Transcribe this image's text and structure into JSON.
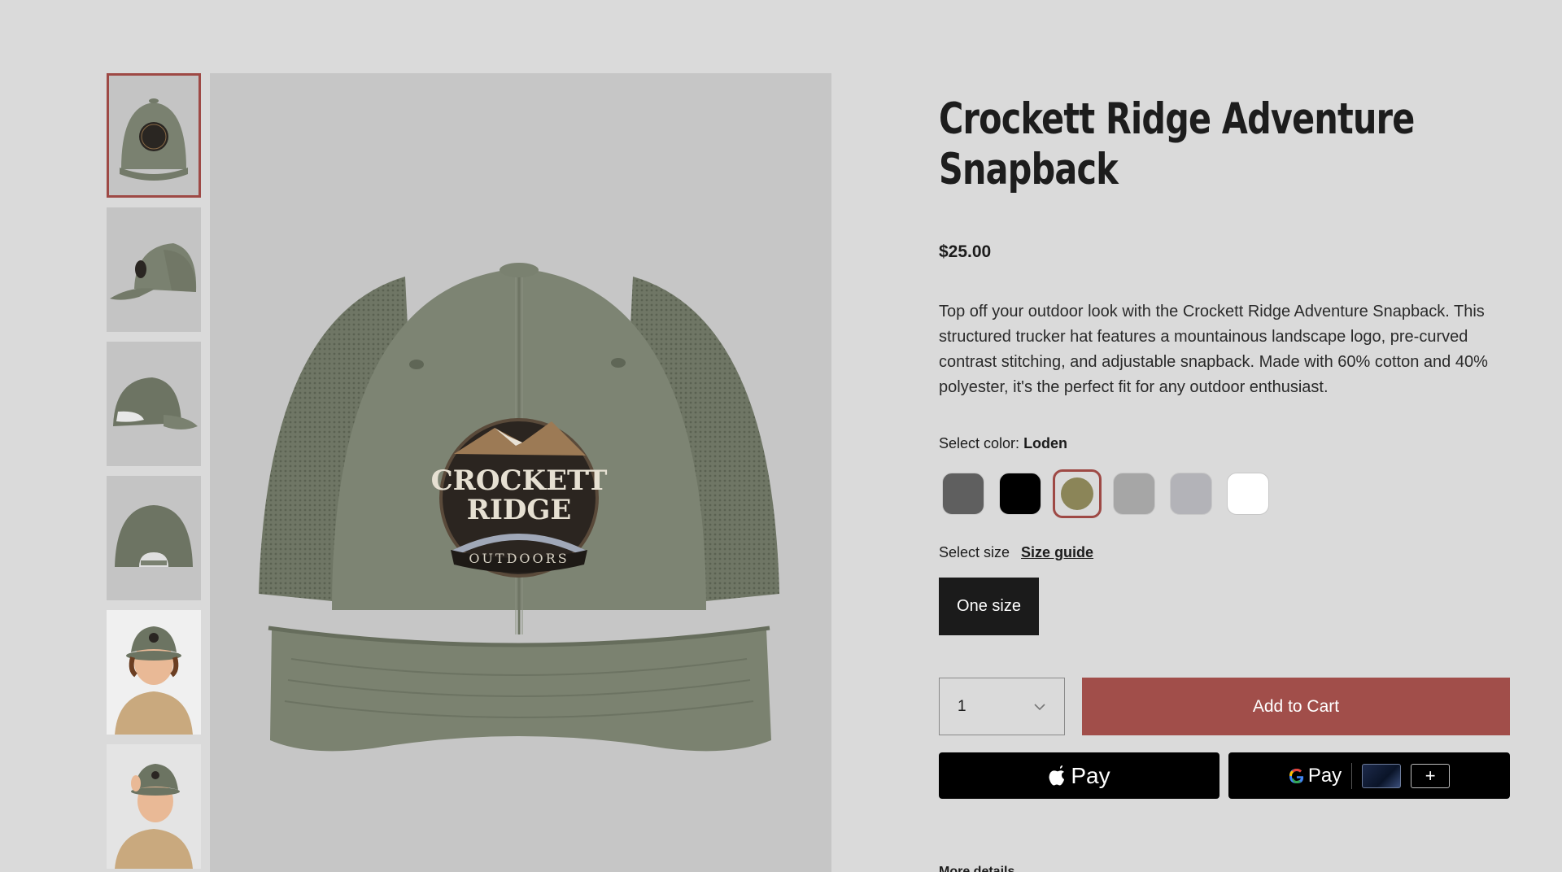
{
  "product": {
    "title": "Crockett Ridge Adventure Snapback",
    "price": "$25.00",
    "description": "Top off your outdoor look with the Crockett Ridge Adventure Snapback. This structured trucker hat features a mountainous landscape logo, pre-curved contrast stitching, and adjustable snapback. Made with 60% cotton and 40% polyester, it's the perfect fit for any outdoor enthusiast."
  },
  "color": {
    "label": "Select color:",
    "selected": "Loden",
    "swatches": [
      {
        "name": "charcoal",
        "hex": "#5f5f5f"
      },
      {
        "name": "black",
        "hex": "#000000"
      },
      {
        "name": "loden",
        "hex": "#8b8558"
      },
      {
        "name": "grey",
        "hex": "#a6a6a6"
      },
      {
        "name": "light-grey",
        "hex": "#b3b3b8"
      },
      {
        "name": "white",
        "hex": "#ffffff"
      }
    ]
  },
  "size": {
    "label": "Select size",
    "guide_label": "Size guide",
    "option": "One size"
  },
  "quantity": {
    "value": "1"
  },
  "cart": {
    "add_label": "Add to Cart"
  },
  "payments": {
    "apple_label": "Pay",
    "google_label": "Pay",
    "google_plus": "+"
  },
  "logo_text": {
    "line1": "CROCKETT",
    "line2": "RIDGE",
    "line3": "OUTDOORS"
  },
  "colors": {
    "accent": "#a14e4a",
    "hat": "#7d8473",
    "background": "#dadada"
  },
  "more": {
    "label": "More details"
  }
}
